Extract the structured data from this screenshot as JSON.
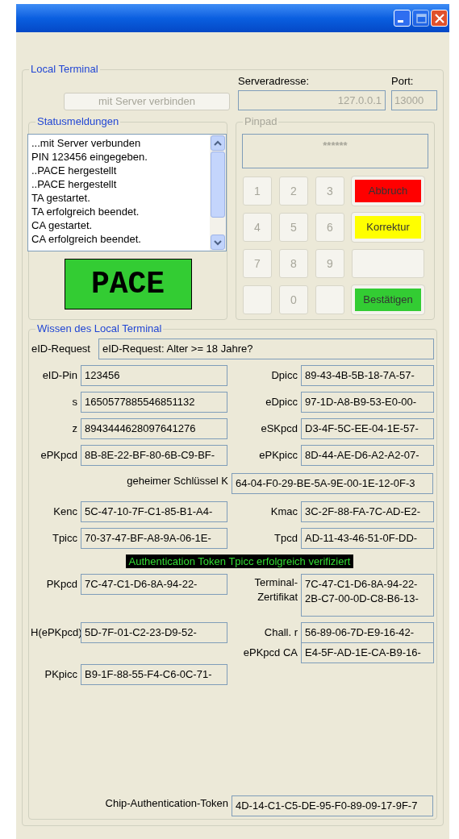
{
  "window": {
    "buttons": [
      {
        "kind": "minimize",
        "disabled": false
      },
      {
        "kind": "maximize",
        "disabled": true
      },
      {
        "kind": "close",
        "disabled": false
      }
    ]
  },
  "local_terminal": {
    "title": "Local Terminal",
    "connect_button": {
      "label": "mit Server verbinden",
      "disabled": true
    },
    "server_address": {
      "label": "Serveradresse:",
      "value": "127.0.0.1"
    },
    "port": {
      "label": "Port:",
      "value": "13000"
    }
  },
  "status": {
    "title": "Statusmeldungen",
    "messages": [
      "...mit Server verbunden",
      "PIN 123456 eingegeben.",
      "..PACE hergestellt",
      "..PACE hergestellt",
      "TA gestartet.",
      "TA erfolgreich beendet.",
      "CA gestartet.",
      "CA erfolgreich beendet."
    ],
    "badge": "PACE"
  },
  "pinpad": {
    "title": "Pinpad",
    "display": "******",
    "keys": [
      {
        "kind": "digit",
        "label": "1"
      },
      {
        "kind": "digit",
        "label": "2"
      },
      {
        "kind": "digit",
        "label": "3"
      },
      {
        "kind": "action",
        "label": "Abbruch",
        "color": "#ff0000"
      },
      {
        "kind": "digit",
        "label": "4"
      },
      {
        "kind": "digit",
        "label": "5"
      },
      {
        "kind": "digit",
        "label": "6"
      },
      {
        "kind": "action",
        "label": "Korrektur",
        "color": "#ffff00"
      },
      {
        "kind": "digit",
        "label": "7"
      },
      {
        "kind": "digit",
        "label": "8"
      },
      {
        "kind": "digit",
        "label": "9"
      },
      {
        "kind": "blank"
      },
      {
        "kind": "blank"
      },
      {
        "kind": "digit",
        "label": "0"
      },
      {
        "kind": "blank"
      },
      {
        "kind": "action",
        "label": "Bestätigen",
        "color": "#33cc33"
      }
    ]
  },
  "knowledge": {
    "title": "Wissen des Local Terminal",
    "rows": [
      {
        "kind": "full",
        "label": "eID-Request",
        "value": "eID-Request: Alter >= 18 Jahre?"
      },
      {
        "kind": "pair",
        "left": {
          "label": "eID-Pin",
          "value": "123456"
        },
        "right": {
          "label": "Dpicc",
          "value": "89-43-4B-5B-18-7A-57-"
        }
      },
      {
        "kind": "pair",
        "left": {
          "label": "s",
          "value": "1650577885546851132"
        },
        "right": {
          "label": "eDpicc",
          "value": "97-1D-A8-B9-53-E0-00-"
        }
      },
      {
        "kind": "pair",
        "left": {
          "label": "z",
          "value": "8943444628097641276"
        },
        "right": {
          "label": "eSKpcd",
          "value": "D3-4F-5C-EE-04-1E-57-"
        }
      },
      {
        "kind": "pair",
        "left": {
          "label": "ePKpcd",
          "value": "8B-8E-22-BF-80-6B-C9-BF-"
        },
        "right": {
          "label": "ePKpicc",
          "value": "8D-44-AE-D6-A2-A2-07-"
        }
      },
      {
        "kind": "wide",
        "label": "geheimer Schlüssel K",
        "value": "64-04-F0-29-BE-5A-9E-00-1E-12-0F-3"
      },
      {
        "kind": "pair",
        "left": {
          "label": "Kenc",
          "value": "5C-47-10-7F-C1-85-B1-A4-"
        },
        "right": {
          "label": "Kmac",
          "value": "3C-2F-88-FA-7C-AD-E2-"
        }
      },
      {
        "kind": "pair",
        "left": {
          "label": "Tpicc",
          "value": "70-37-47-BF-A8-9A-06-1E-"
        },
        "right": {
          "label": "Tpcd",
          "value": "AD-11-43-46-51-0F-DD-"
        }
      },
      {
        "kind": "banner",
        "text": "Authentication Token Tpicc erfolgreich verifiziert"
      },
      {
        "kind": "tall",
        "left": {
          "label": "PKpcd",
          "value": "7C-47-C1-D6-8A-94-22-"
        },
        "right": {
          "label_lines": [
            "Terminal-",
            "Zertifikat"
          ],
          "lines": [
            "7C-47-C1-D6-8A-94-22-",
            "2B-C7-00-0D-C8-B6-13-"
          ]
        }
      },
      {
        "kind": "pair",
        "left": {
          "label": "H(ePKpcd)",
          "value": "5D-7F-01-C2-23-D9-52-"
        },
        "right": {
          "label": "Chall. r",
          "value": "56-89-06-7D-E9-16-42-"
        }
      },
      {
        "kind": "right_only",
        "right": {
          "label": "ePKpcd CA",
          "value": "E4-5F-AD-1E-CA-B9-16-"
        }
      },
      {
        "kind": "left_only",
        "left": {
          "label": "PKpicc",
          "value": "B9-1F-88-55-F4-C6-0C-71-"
        }
      },
      {
        "kind": "wide_bottom",
        "label": "Chip-Authentication-Token",
        "value": "4D-14-C1-C5-DE-95-F0-89-09-17-9F-7"
      }
    ]
  }
}
